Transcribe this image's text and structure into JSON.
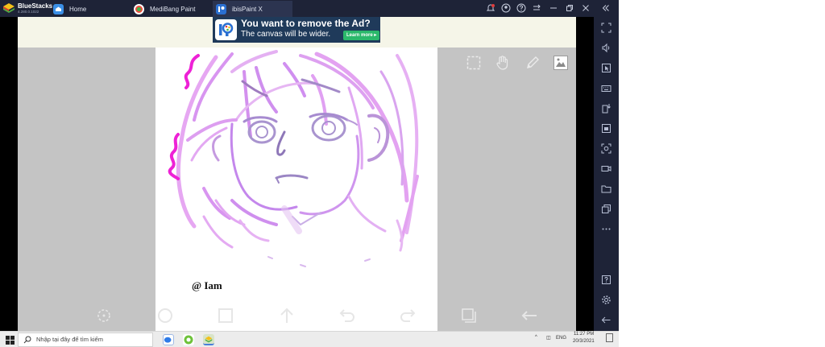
{
  "app": {
    "name": "BlueStacks",
    "version": "4.280.0.1022"
  },
  "tabs": [
    {
      "label": "Home",
      "icon": "home-icon"
    },
    {
      "label": "MediBang Paint",
      "icon": "medibang-icon"
    },
    {
      "label": "ibisPaint X",
      "icon": "ibispaint-icon"
    }
  ],
  "titlebar_icons": [
    "notification-bell-icon",
    "account-icon",
    "help-icon",
    "menu-icon",
    "minimize-icon",
    "restore-icon",
    "close-icon",
    "collapse-sidebar-icon"
  ],
  "ad": {
    "headline": "You want to remove the Ad?",
    "subline": "The canvas will be wider.",
    "button": "Learn more ▸"
  },
  "canvas": {
    "watermark": "@ Iam"
  },
  "tools_top": [
    "selection-icon",
    "hand-icon",
    "pen-icon",
    "layer-thumbnail-icon"
  ],
  "tools_bottom": [
    "rotate-icon",
    "circle-icon",
    "square-icon",
    "arrow-up-icon",
    "undo-icon",
    "redo-icon",
    "layers-icon",
    "back-arrow-icon"
  ],
  "sidebar_icons": [
    "fullscreen-icon",
    "volume-icon",
    "pointer-icon",
    "keyboard-icon",
    "install-apk-icon",
    "screenshot-folder-icon",
    "screenshot-icon",
    "record-icon",
    "folder-icon",
    "multi-instance-icon",
    "more-icon",
    "help-icon",
    "settings-icon",
    "back-icon"
  ],
  "taskbar": {
    "search_placeholder": "Nhập tại đây để tìm kiếm",
    "tray_lang": "ENG",
    "time": "11:27 PM",
    "date": "20/3/2021"
  },
  "colors": {
    "bluestacks_bar": "#1e2337",
    "workspace": "#c4c4c4",
    "ad_background": "#1f3a5a",
    "stroke_violet": "#d99cf0",
    "stroke_magenta": "#ee21d6",
    "stroke_purple": "#a78bd0"
  }
}
